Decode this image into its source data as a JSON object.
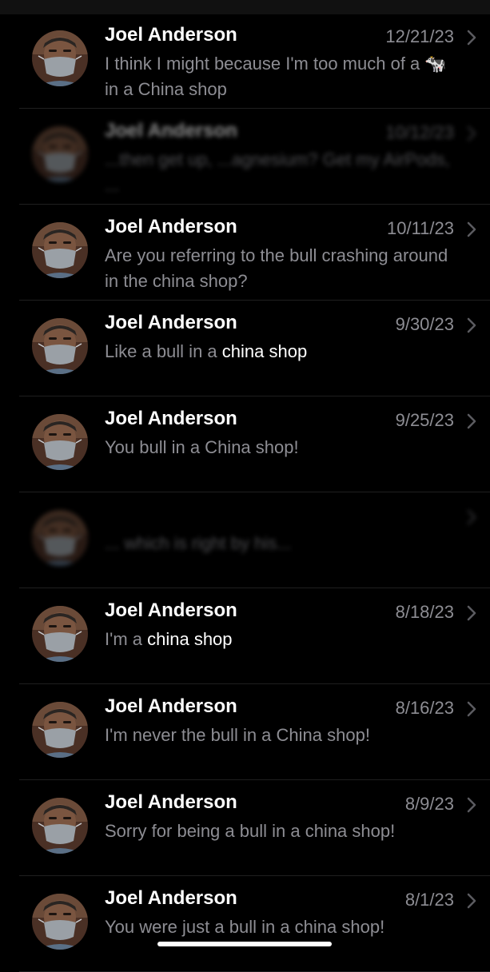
{
  "conversations": [
    {
      "name": "Joel Anderson",
      "date": "12/21/23",
      "preview": "I think I might because I'm too much of a 🐄 in a China shop",
      "highlight": "",
      "blurred": false
    },
    {
      "name": "Joel Anderson",
      "date": "10/12/23",
      "preview": "...then get up, ...agnesium? Get my AirPods, ...",
      "highlight": "",
      "blurred": true
    },
    {
      "name": "Joel Anderson",
      "date": "10/11/23",
      "preview": "Are you referring to the bull crashing around in the china shop?",
      "highlight": "",
      "blurred": false
    },
    {
      "name": "Joel Anderson",
      "date": "9/30/23",
      "preview": "Like a bull in a ",
      "highlight": "china shop",
      "blurred": false
    },
    {
      "name": "Joel Anderson",
      "date": "9/25/23",
      "preview": "You bull in a China shop!",
      "highlight": "",
      "blurred": false
    },
    {
      "name": "",
      "date": "",
      "preview": "... which is right by his...",
      "highlight": "",
      "blurred": true
    },
    {
      "name": "Joel Anderson",
      "date": "8/18/23",
      "preview": "I'm a ",
      "highlight": "china shop",
      "blurred": false
    },
    {
      "name": "Joel Anderson",
      "date": "8/16/23",
      "preview": "I'm never the bull in a China shop!",
      "highlight": "",
      "blurred": false
    },
    {
      "name": "Joel Anderson",
      "date": "8/9/23",
      "preview": "Sorry for being a bull in a china shop!",
      "highlight": "",
      "blurred": false
    },
    {
      "name": "Joel Anderson",
      "date": "8/1/23",
      "preview": "You were just a bull in a china shop!",
      "highlight": "",
      "blurred": false
    }
  ],
  "icons": {
    "chevron": "chevron-right-icon",
    "avatar": "contact-avatar"
  },
  "colors": {
    "background": "#000000",
    "secondary_text": "#8d8d93",
    "primary_text": "#ffffff"
  }
}
